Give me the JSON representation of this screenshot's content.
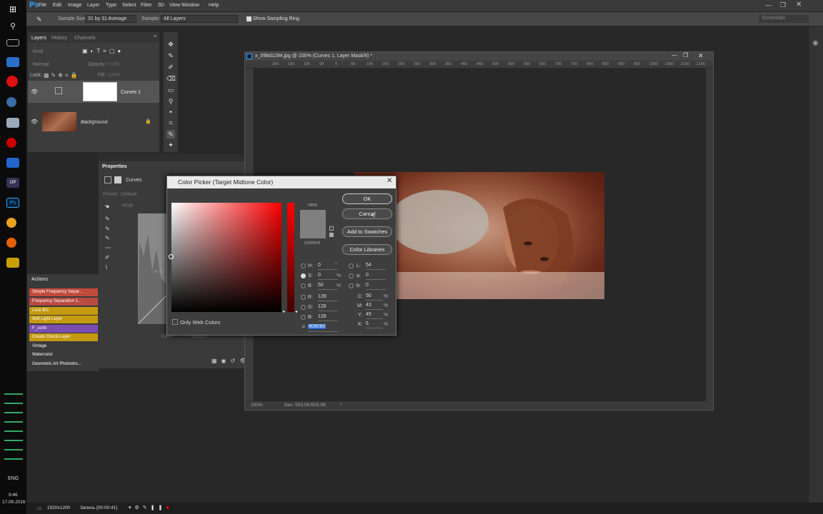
{
  "app": {
    "logo": "Ps"
  },
  "menu": [
    "File",
    "Edit",
    "Image",
    "Layer",
    "Type",
    "Select",
    "Filter",
    "3D",
    "View",
    "Window",
    "Help"
  ],
  "options": {
    "sample_size_label": "Sample Size:",
    "sample_size_value": "31 by 31 Average",
    "sample_label": "Sample:",
    "sample_value": "All Layers",
    "show_ring": "Show Sampling Ring",
    "workspace": "Essentials"
  },
  "layers_panel": {
    "tabs": [
      "Layers",
      "History",
      "Channels"
    ],
    "kind": "Kind",
    "blend": "Normal",
    "opacity_label": "Opacity:",
    "opacity_value": "100%",
    "lock_label": "Lock:",
    "fill_label": "Fill:",
    "fill_value": "100%",
    "layers": [
      {
        "name": "Curves 1"
      },
      {
        "name": "Background"
      }
    ]
  },
  "properties": {
    "title": "Properties",
    "type": "Curves",
    "preset_label": "Preset:",
    "preset_value": "Default",
    "channel": "RGB",
    "input": "Input:",
    "output": "Output:"
  },
  "actions": {
    "title": "Actions",
    "items": [
      "Simple Frequency Separ...",
      "Frequency Separation 1...",
      "Lock BG",
      "Soft Light Layer",
      "F_contr",
      "Create Check-Layer",
      "Vintage",
      "Watercolor",
      "Geometric Art Photosho..."
    ]
  },
  "document": {
    "title": "x_098d1294.jpg @ 100% (Curves 1, Layer Mask/8) *",
    "zoom": "100%",
    "doc_info": "Doc: 503.0K/503.0K",
    "ruler": [
      "200",
      "150",
      "100",
      "50",
      "0",
      "50",
      "100",
      "150",
      "200",
      "250",
      "300",
      "350",
      "400",
      "450",
      "500",
      "550",
      "600",
      "650",
      "700",
      "750",
      "800",
      "850",
      "900",
      "950",
      "1000",
      "1050",
      "1100",
      "1150"
    ]
  },
  "color_picker": {
    "title": "Color Picker (Target Midtone Color)",
    "ok": "OK",
    "cancel": "Cancel",
    "add_swatches": "Add to Swatches",
    "color_libraries": "Color Libraries",
    "new_label": "new",
    "current_label": "current",
    "only_web": "Only Web Colors",
    "fields": {
      "H": "0",
      "S": "0",
      "B": "50",
      "R": "128",
      "G": "128",
      "Bv": "128",
      "L": "54",
      "a": "0",
      "b": "0",
      "C": "50",
      "M": "43",
      "Y": "45",
      "K": "6",
      "hex": "808080"
    },
    "units": {
      "deg": "°",
      "pct": "%"
    },
    "current_color": "#808080",
    "accent": "#c00000"
  },
  "statusbar": {
    "resolution": "1920x1200",
    "recording": "Запись [00:00:41]",
    "lang": "ENG",
    "time": "9:46",
    "date": "17.09.2016"
  }
}
